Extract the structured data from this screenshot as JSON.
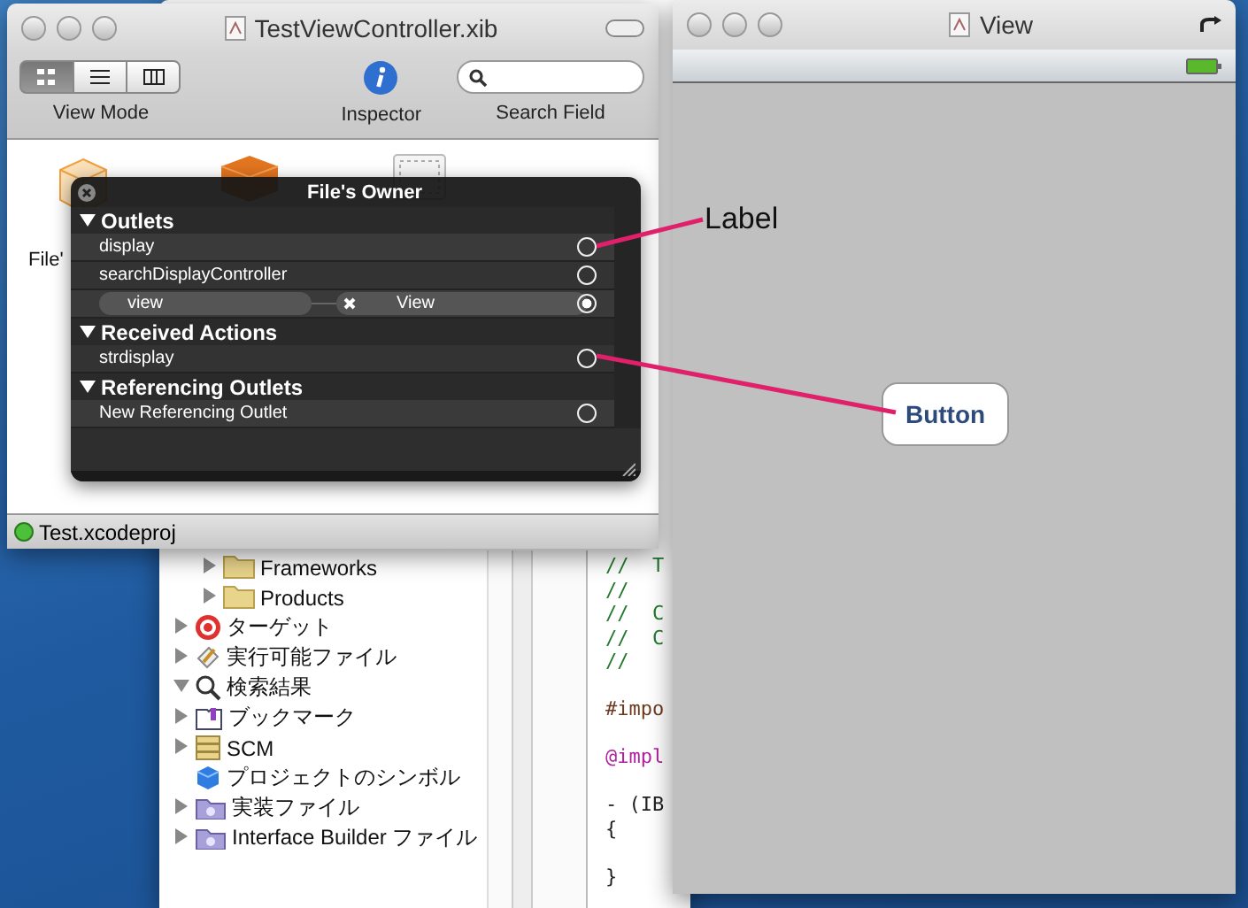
{
  "project_window": {
    "tree": [
      {
        "label": "Frameworks",
        "kind": "folder",
        "expanded": false
      },
      {
        "label": "Products",
        "kind": "folder",
        "expanded": false
      },
      {
        "label": "ターゲット",
        "kind": "target",
        "expanded": false
      },
      {
        "label": "実行可能ファイル",
        "kind": "executable",
        "expanded": false
      },
      {
        "label": "検索結果",
        "kind": "search",
        "expanded": true
      },
      {
        "label": "ブックマーク",
        "kind": "bookmark",
        "expanded": false
      },
      {
        "label": "SCM",
        "kind": "scm",
        "expanded": false
      },
      {
        "label": "プロジェクトのシンボル",
        "kind": "symbol"
      },
      {
        "label": "実装ファイル",
        "kind": "smartfolder",
        "expanded": false
      },
      {
        "label": "Interface Builder ファイル",
        "kind": "smartfolder",
        "expanded": false
      }
    ],
    "code_lines": [
      {
        "text": "//  T",
        "kind": "comment"
      },
      {
        "text": "//",
        "kind": "comment"
      },
      {
        "text": "//  C",
        "kind": "comment"
      },
      {
        "text": "//  C",
        "kind": "comment"
      },
      {
        "text": "//",
        "kind": "comment"
      },
      {
        "kind": "blank"
      },
      {
        "text": "#impo",
        "kind": "directive"
      },
      {
        "kind": "blank"
      },
      {
        "text": "@impl",
        "kind": "keyword"
      },
      {
        "kind": "blank"
      },
      {
        "text": "- (IB",
        "kind": "method"
      },
      {
        "text": "{",
        "kind": "plain"
      },
      {
        "kind": "blank"
      },
      {
        "text": "}",
        "kind": "plain"
      }
    ]
  },
  "doc_window": {
    "title": "TestViewController.xib",
    "view_modes": [
      {
        "selected": true
      },
      {
        "selected": false
      },
      {
        "selected": false
      }
    ],
    "view_mode_label": "View Mode",
    "inspector_label": "Inspector",
    "search_label": "Search Field",
    "object_label": "File'",
    "status": "Test.xcodeproj"
  },
  "connections_panel": {
    "title": "File's Owner",
    "sections": [
      {
        "title": "Outlets",
        "expanded": true,
        "items": [
          {
            "name": "display",
            "connected": false
          },
          {
            "name": "searchDisplayController",
            "connected": false
          },
          {
            "name": "view",
            "connected": true,
            "target": "View"
          }
        ]
      },
      {
        "title": "Received Actions",
        "expanded": true,
        "items": [
          {
            "name": "strdisplay",
            "connected": false
          }
        ]
      },
      {
        "title": "Referencing Outlets",
        "expanded": true,
        "items": [
          {
            "name": "New Referencing Outlet",
            "connected": false
          }
        ]
      }
    ]
  },
  "view_window": {
    "title": "View",
    "label": "Label",
    "button": "Button"
  }
}
